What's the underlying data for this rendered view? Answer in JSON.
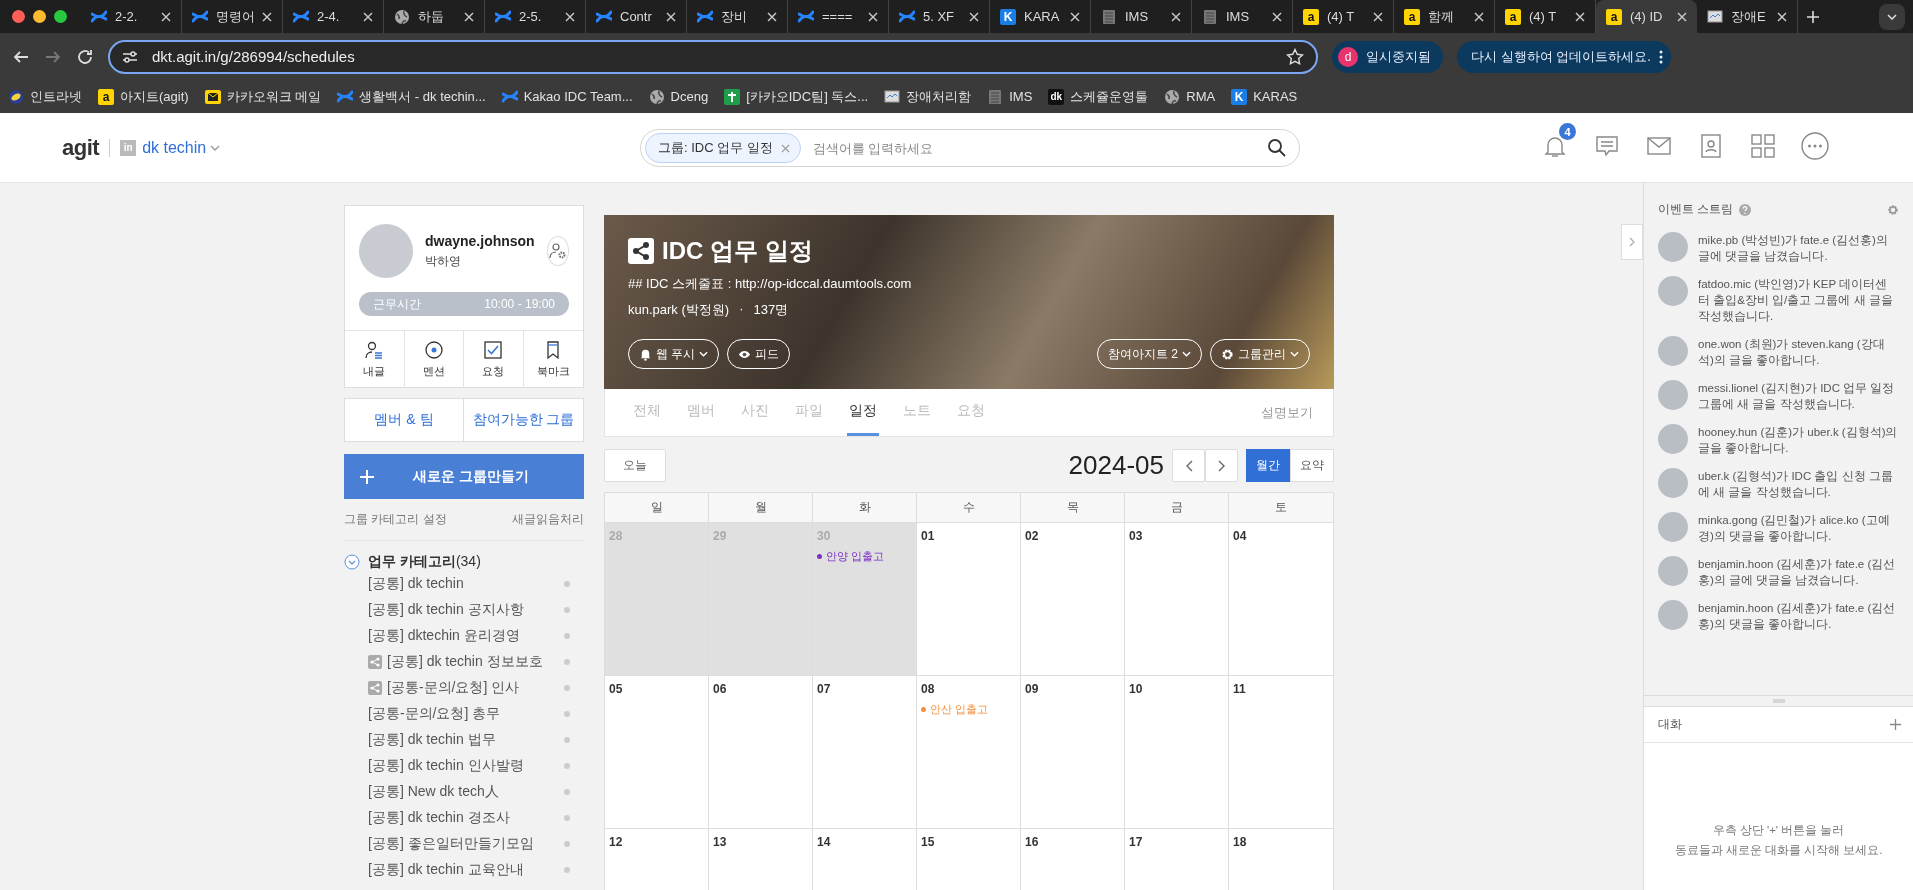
{
  "browser": {
    "tabs": [
      {
        "title": "2-2.",
        "kind": "confluence",
        "selected": false
      },
      {
        "title": "명령어",
        "kind": "confluence",
        "selected": false
      },
      {
        "title": "2-4.",
        "kind": "confluence",
        "selected": false
      },
      {
        "title": "하둡",
        "kind": "globe",
        "selected": false
      },
      {
        "title": "2-5.",
        "kind": "confluence",
        "selected": false
      },
      {
        "title": "Contr",
        "kind": "confluence",
        "selected": false
      },
      {
        "title": "장비",
        "kind": "confluence",
        "selected": false
      },
      {
        "title": "====",
        "kind": "confluence",
        "selected": false
      },
      {
        "title": "5. XF",
        "kind": "confluence",
        "selected": false
      },
      {
        "title": "KARA",
        "kind": "kakao-k",
        "glyph": "K",
        "selected": false
      },
      {
        "title": "IMS",
        "kind": "server",
        "selected": false
      },
      {
        "title": "IMS",
        "kind": "server",
        "selected": false
      },
      {
        "title": "(4) T",
        "kind": "agit",
        "glyph": "a",
        "selected": false
      },
      {
        "title": "함께",
        "kind": "agit",
        "glyph": "a",
        "selected": false
      },
      {
        "title": "(4) T",
        "kind": "agit",
        "glyph": "a",
        "selected": false
      },
      {
        "title": "(4) ID",
        "kind": "agit",
        "glyph": "a",
        "selected": true
      },
      {
        "title": "장애E",
        "kind": "monitor",
        "selected": false
      }
    ],
    "address": "dkt.agit.in/g/286994/schedules",
    "profile": {
      "initial": "d",
      "label": "일시중지됨"
    },
    "update_label": "다시 실행하여 업데이트하세요.",
    "bookmarks": [
      {
        "title": "인트라넷",
        "kind": "intranet"
      },
      {
        "title": "아지트(agit)",
        "kind": "agit",
        "glyph": "a"
      },
      {
        "title": "카카오워크 메일",
        "kind": "mail"
      },
      {
        "title": "생활백서 - dk techin...",
        "kind": "confluence"
      },
      {
        "title": "Kakao IDC Team...",
        "kind": "confluence"
      },
      {
        "title": "Dceng",
        "kind": "globe"
      },
      {
        "title": "[카카오IDC팀] 독스...",
        "kind": "sheets"
      },
      {
        "title": "장애처리함",
        "kind": "monitor"
      },
      {
        "title": "IMS",
        "kind": "server"
      },
      {
        "title": "스케쥴운영툴",
        "kind": "dk",
        "glyph": "dk"
      },
      {
        "title": "RMA",
        "kind": "globe"
      },
      {
        "title": "KARAS",
        "kind": "kakao-k",
        "glyph": "K"
      }
    ]
  },
  "header": {
    "logo": "agit",
    "org_badge": "in",
    "org_name": "dk techin",
    "search": {
      "chip": "그룹: IDC 업무 일정",
      "placeholder": "검색어를 입력하세요"
    },
    "notification_count": "4"
  },
  "sidebar": {
    "profile": {
      "user_id": "dwayne.johnson",
      "name": "박하영",
      "work_label": "근무시간",
      "work_hours": "10:00 - 19:00"
    },
    "shortcuts": [
      {
        "label": "내글",
        "kind": "my-posts"
      },
      {
        "label": "멘션",
        "kind": "mention"
      },
      {
        "label": "요청",
        "kind": "request"
      },
      {
        "label": "북마크",
        "kind": "bookmark"
      }
    ],
    "group_buttons": [
      "멤버 & 팀",
      "참여가능한 그룹"
    ],
    "new_group": "새로운 그룹만들기",
    "links": [
      "그룹 카테고리 설정",
      "새글읽음처리"
    ],
    "category": {
      "title": "**업무 카테고리**(34)",
      "expanded": true,
      "items": [
        {
          "name": "[공통] dk techin",
          "shared": false
        },
        {
          "name": "[공통] dk techin 공지사항",
          "shared": false
        },
        {
          "name": "[공통] dktechin 윤리경영",
          "shared": false
        },
        {
          "name": "[공통] dk techin 정보보호",
          "shared": true
        },
        {
          "name": "[공통-문의/요청] 인사",
          "shared": true
        },
        {
          "name": "[공통-문의/요청] 총무",
          "shared": false
        },
        {
          "name": "[공통] dk techin 법무",
          "shared": false
        },
        {
          "name": "[공통] dk techin 인사발령",
          "shared": false
        },
        {
          "name": "[공통] New dk tech人",
          "shared": false
        },
        {
          "name": "[공통] dk techin 경조사",
          "shared": false
        },
        {
          "name": "[공통] 좋은일터만들기모임",
          "shared": false
        },
        {
          "name": "[공통] dk techin 교육안내",
          "shared": false
        }
      ]
    }
  },
  "group": {
    "title": "IDC 업무 일정",
    "description": "## IDC 스케줄표 : http://op-idccal.daumtools.com",
    "owner": "kun.park (박정원)",
    "separator": "·",
    "members": "137명",
    "actions_left": [
      {
        "label": "웹 푸시",
        "kind": "bell",
        "caret": true
      },
      {
        "label": "피드",
        "kind": "eye",
        "caret": false
      }
    ],
    "actions_right": [
      {
        "label": "참여아지트 2",
        "kind": "plain",
        "caret": true
      },
      {
        "label": "그룹관리",
        "kind": "gear",
        "caret": true
      }
    ],
    "tabs": [
      {
        "label": "전체",
        "selected": false
      },
      {
        "label": "멤버",
        "selected": false
      },
      {
        "label": "사진",
        "selected": false
      },
      {
        "label": "파일",
        "selected": false
      },
      {
        "label": "일정",
        "selected": true
      },
      {
        "label": "노트",
        "selected": false
      },
      {
        "label": "요청",
        "selected": false
      }
    ],
    "description_link": "설명보기"
  },
  "calendar": {
    "today": "오늘",
    "month": "2024-05",
    "views": [
      {
        "label": "월간",
        "selected": true
      },
      {
        "label": "요약",
        "selected": false
      }
    ],
    "weekdays": [
      "일",
      "월",
      "화",
      "수",
      "목",
      "금",
      "토"
    ],
    "weeks": [
      {
        "days": [
          {
            "day": "28",
            "other_month": true
          },
          {
            "day": "29",
            "other_month": true
          },
          {
            "day": "30",
            "other_month": true,
            "events": [
              {
                "title": "안양 입출고",
                "color": "#7b2fc4"
              }
            ]
          },
          {
            "day": "01",
            "other_month": false
          },
          {
            "day": "02",
            "other_month": false
          },
          {
            "day": "03",
            "other_month": false
          },
          {
            "day": "04",
            "other_month": false
          }
        ]
      },
      {
        "days": [
          {
            "day": "05",
            "other_month": false
          },
          {
            "day": "06",
            "other_month": false
          },
          {
            "day": "07",
            "other_month": false
          },
          {
            "day": "08",
            "other_month": false,
            "events": [
              {
                "title": "안산 입출고",
                "color": "#f5913e"
              }
            ]
          },
          {
            "day": "09",
            "other_month": false
          },
          {
            "day": "10",
            "other_month": false
          },
          {
            "day": "11",
            "other_month": false
          }
        ]
      },
      {
        "days": [
          {
            "day": "12",
            "other_month": false
          },
          {
            "day": "13",
            "other_month": false
          },
          {
            "day": "14",
            "other_month": false
          },
          {
            "day": "15",
            "other_month": false
          },
          {
            "day": "16",
            "other_month": false
          },
          {
            "day": "17",
            "other_month": false
          },
          {
            "day": "18",
            "other_month": false
          }
        ]
      }
    ]
  },
  "event_stream": {
    "title": "이벤트 스트림",
    "items": [
      "mike.pb (박성빈)가 fate.e (김선홍)의 글에 댓글을 남겼습니다.",
      "fatdoo.mic (박인영)가 KEP 데이터센터 출입&장비 입/출고 그룹에 새 글을 작성했습니다.",
      "one.won (최원)가 steven.kang (강대석)의 글을 좋아합니다.",
      "messi.lionel (김지현)가 IDC 업무 일정 그룹에 새 글을 작성했습니다.",
      "hooney.hun (김훈)가 uber.k (김형석)의 글을 좋아합니다.",
      "uber.k (김형석)가 IDC 출입 신청 그룹에 새 글을 작성했습니다.",
      "minka.gong (김민철)가 alice.ko (고예경)의 댓글을 좋아합니다.",
      "benjamin.hoon (김세훈)가 fate.e (김선홍)의 글에 댓글을 남겼습니다.",
      "benjamin.hoon (김세훈)가 fate.e (김선홍)의 댓글을 좋아합니다."
    ]
  },
  "chat": {
    "title": "대화",
    "empty_message": "우측 상단 '+' 버튼을 눌러\n동료들과 새로운 대화를 시작해 보세요."
  }
}
